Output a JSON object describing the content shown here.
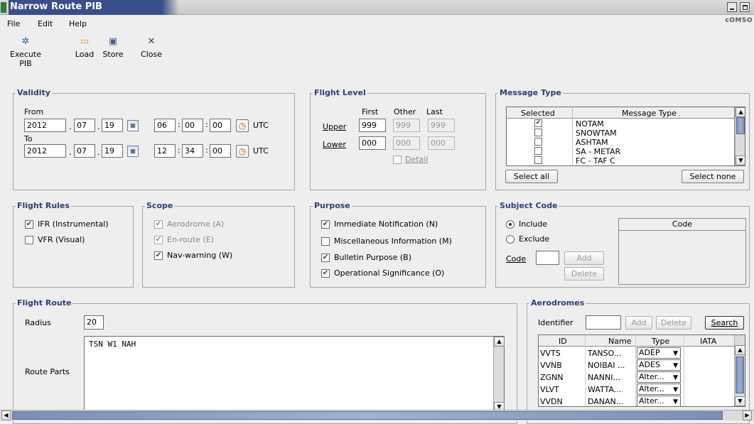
{
  "window": {
    "title": "Narrow Route PIB",
    "brand": "cOMSO"
  },
  "menu": {
    "file": "File",
    "edit": "Edit",
    "help": "Help"
  },
  "toolbar": {
    "execute": "Execute PIB",
    "load": "Load",
    "store": "Store",
    "close": "Close"
  },
  "validity": {
    "title": "Validity",
    "from_label": "From",
    "to_label": "To",
    "from": {
      "year": "2012",
      "month": "07",
      "day": "19",
      "hh": "06",
      "mm": "00",
      "ss": "00"
    },
    "to": {
      "year": "2012",
      "month": "07",
      "day": "19",
      "hh": "12",
      "mm": "34",
      "ss": "00"
    },
    "utc": "UTC"
  },
  "flight_level": {
    "title": "Flight Level",
    "col_first": "First",
    "col_other": "Other",
    "col_last": "Last",
    "upper_label": "Upper",
    "lower_label": "Lower",
    "upper": {
      "first": "999",
      "other": "999",
      "last": "999"
    },
    "lower": {
      "first": "000",
      "other": "000",
      "last": "000"
    },
    "detail": "Detail"
  },
  "message_type": {
    "title": "Message Type",
    "col_selected": "Selected",
    "col_type": "Message Type",
    "rows": [
      {
        "type": "NOTAM",
        "checked": true
      },
      {
        "type": "SNOWTAM",
        "checked": false
      },
      {
        "type": "ASHTAM",
        "checked": false
      },
      {
        "type": "SA - METAR",
        "checked": false
      },
      {
        "type": "FC - TAF C",
        "checked": false
      }
    ],
    "select_all": "Select all",
    "select_none": "Select none"
  },
  "flight_rules": {
    "title": "Flight Rules",
    "ifr": "IFR (Instrumental)",
    "vfr": "VFR (Visual)"
  },
  "scope": {
    "title": "Scope",
    "aerodrome": "Aerodrome (A)",
    "enroute": "En-route (E)",
    "navwarning": "Nav-warning (W)"
  },
  "purpose": {
    "title": "Purpose",
    "immediate": "Immediate Notification (N)",
    "misc": "Miscellaneous Information (M)",
    "bulletin": "Bulletin Purpose (B)",
    "operational": "Operational Significance (O)"
  },
  "subject_code": {
    "title": "Subject Code",
    "include": "Include",
    "exclude": "Exclude",
    "code_label": "Code",
    "add": "Add",
    "delete": "Delete",
    "col_code": "Code"
  },
  "flight_route": {
    "title": "Flight Route",
    "radius_label": "Radius",
    "radius": "20",
    "route_parts_label": "Route Parts",
    "route_text": "TSN W1 NAH"
  },
  "aerodromes": {
    "title": "Aerodromes",
    "identifier_label": "Identifier",
    "add": "Add",
    "delete": "Delete",
    "search": "Search",
    "cols": {
      "id": "ID",
      "name": "Name",
      "type": "Type",
      "iata": "IATA"
    },
    "rows": [
      {
        "id": "VVTS",
        "name": "TANSO...",
        "type": "ADEP"
      },
      {
        "id": "VVNB",
        "name": "NOIBAI ...",
        "type": "ADES"
      },
      {
        "id": "ZGNN",
        "name": "NANNI...",
        "type": "Alter..."
      },
      {
        "id": "VLVT",
        "name": "WATTA...",
        "type": "Alter..."
      },
      {
        "id": "VVDN",
        "name": "DANAN...",
        "type": "Alter..."
      }
    ]
  }
}
